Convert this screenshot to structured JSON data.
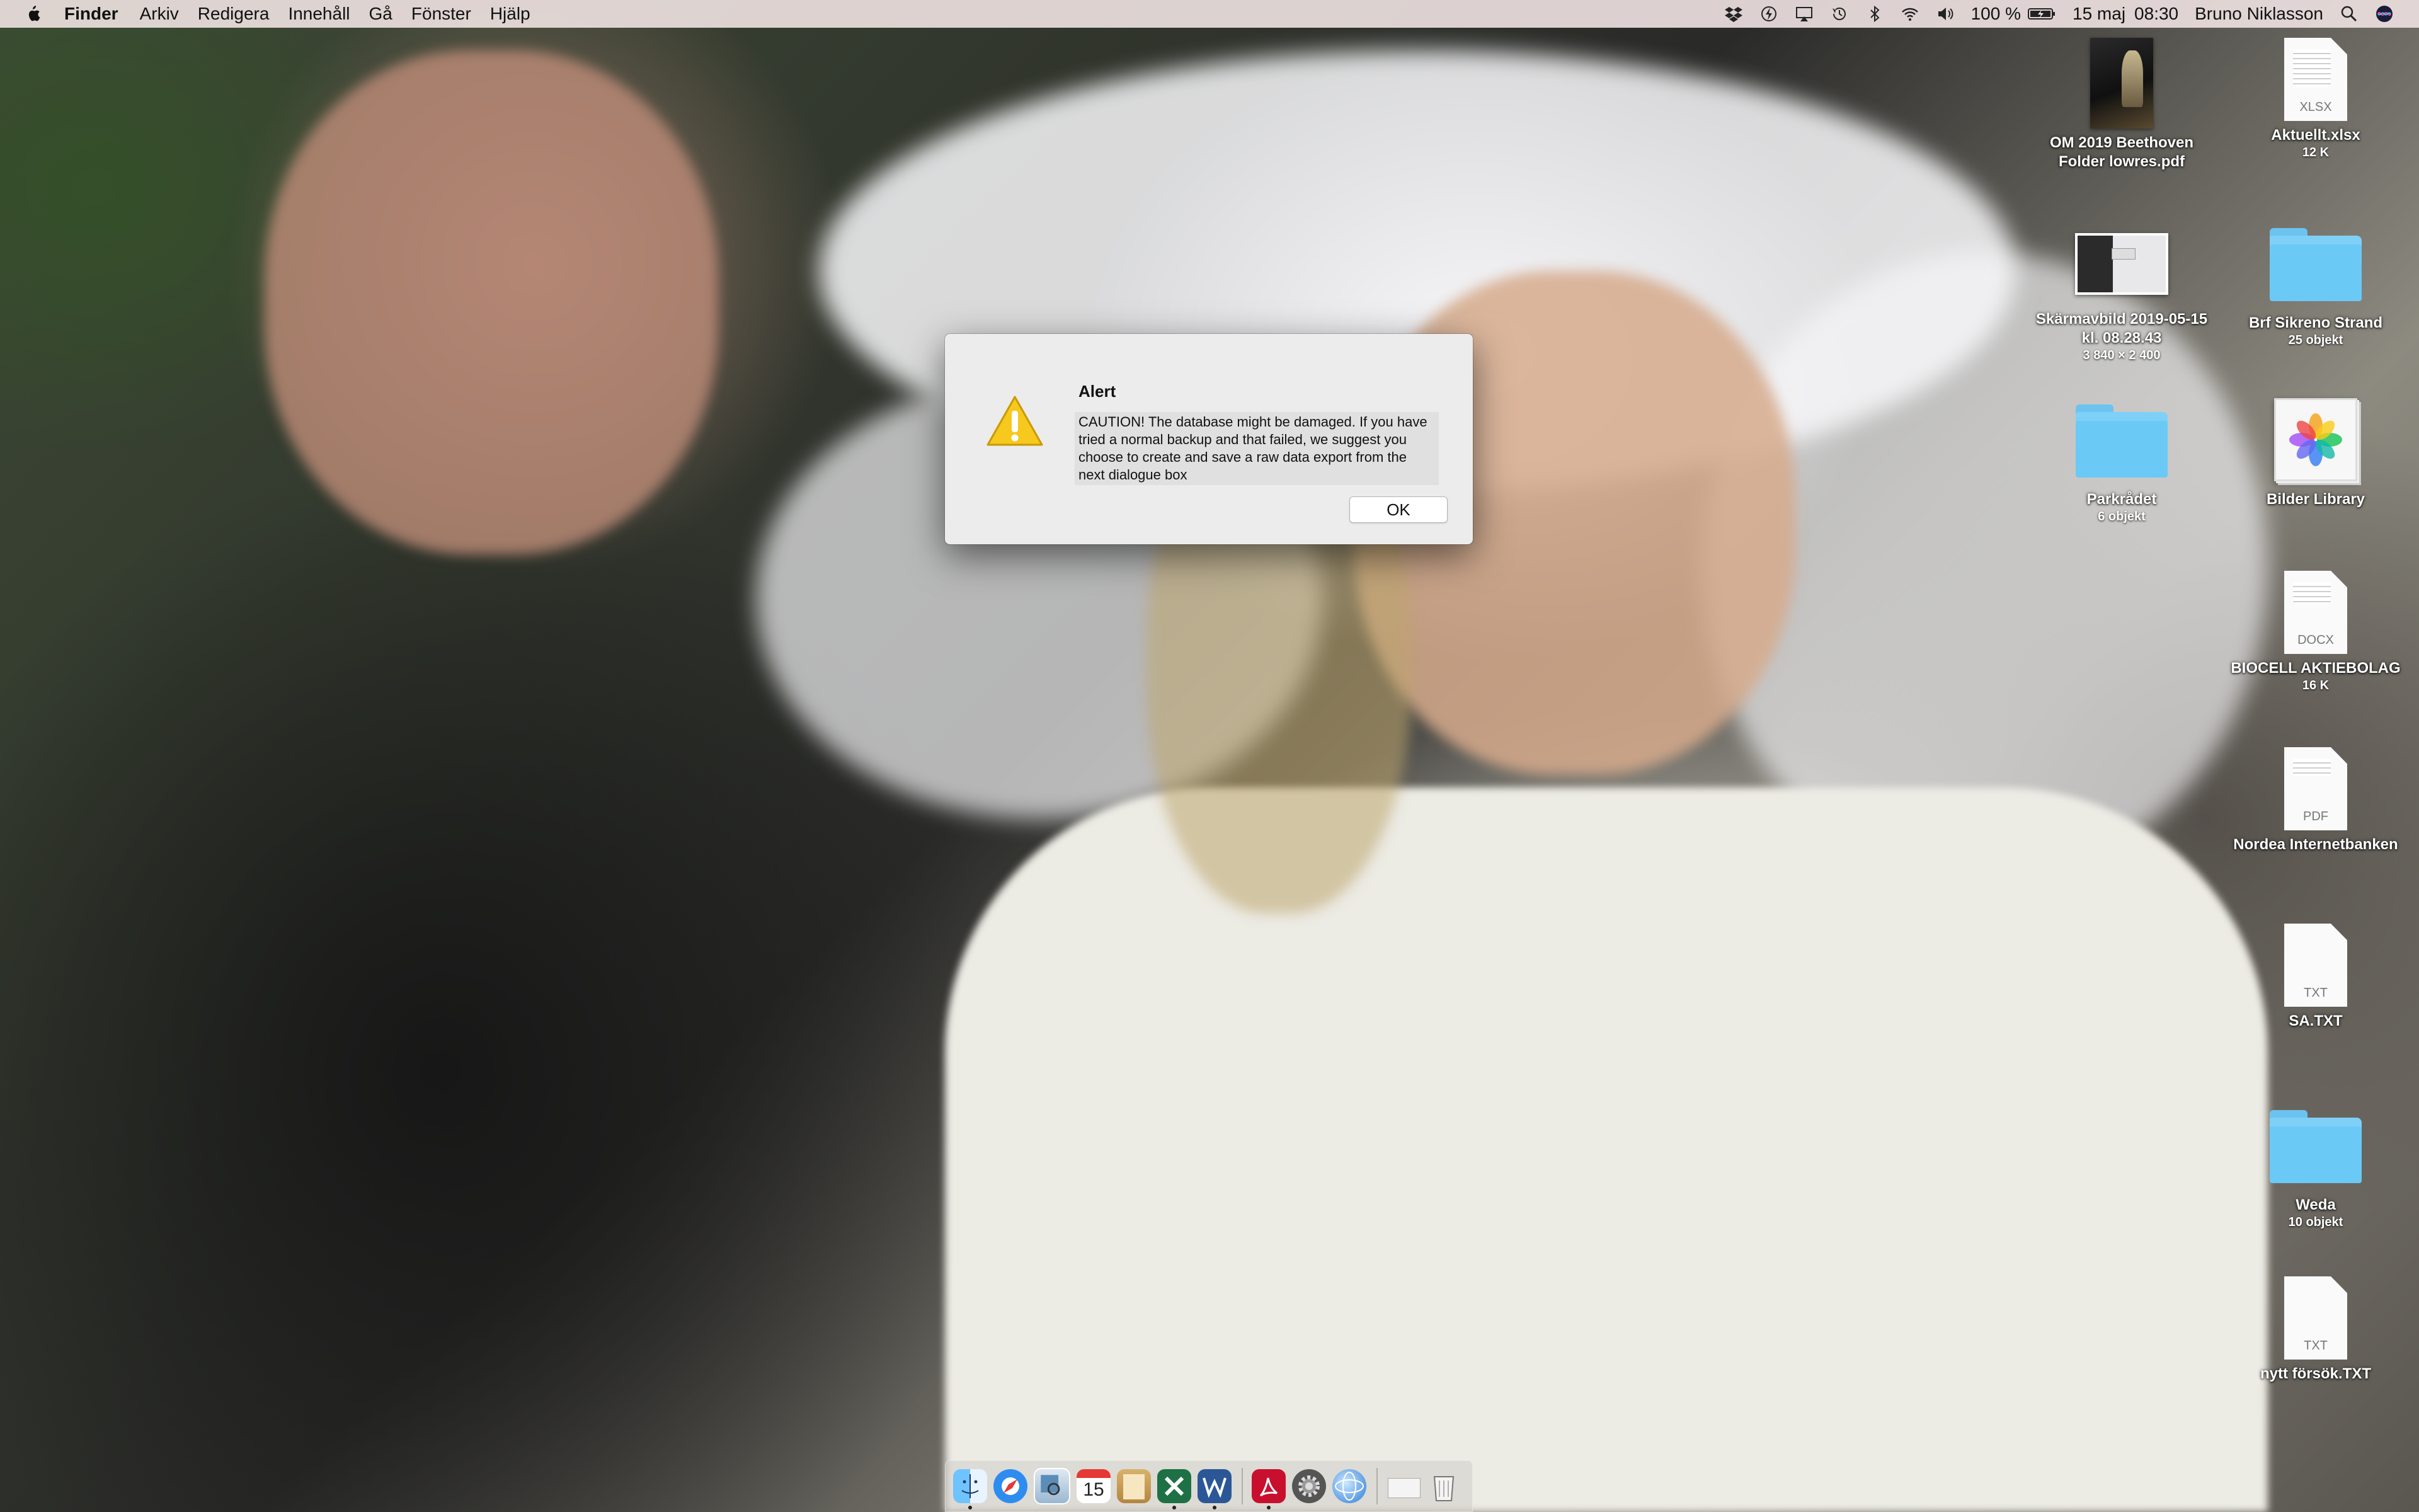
{
  "menubar": {
    "items": [
      "Finder",
      "Arkiv",
      "Redigera",
      "Innehåll",
      "Gå",
      "Fönster",
      "Hjälp"
    ],
    "status": {
      "battery": "100 %",
      "date": "15 maj",
      "time": "08:30",
      "user": "Bruno Niklasson"
    },
    "icons": [
      "dropbox-icon",
      "bolt-icon",
      "airplay-icon",
      "time-machine-icon",
      "bluetooth-icon",
      "wifi-icon",
      "volume-icon",
      "battery-icon",
      "spotlight-icon",
      "siri-icon"
    ]
  },
  "alert": {
    "title": "Alert",
    "message": "CAUTION! The database might be damaged. If you have tried a normal backup and that failed, we suggest you choose to create and save a raw data export from the next dialogue box",
    "ok_label": "OK"
  },
  "desktop_icons": [
    {
      "label": "OM 2019 Beethoven Folder lowres.pdf",
      "sub": "",
      "kind": "pdf-thumbnail"
    },
    {
      "label": "Aktuellt.xlsx",
      "sub": "12 K",
      "kind": "document",
      "ext": "XLSX"
    },
    {
      "label": "Skärmavbild 2019-05-15 kl. 08.28.43",
      "sub": "3 840 × 2 400",
      "kind": "image-thumbnail"
    },
    {
      "label": "Brf Sikreno Strand",
      "sub": "25 objekt",
      "kind": "folder"
    },
    {
      "label": "Parkrådet",
      "sub": "6 objekt",
      "kind": "folder"
    },
    {
      "label": "Bilder Library",
      "sub": "",
      "kind": "photos-library"
    },
    {
      "label": "BIOCELL AKTIEBOLAG",
      "sub": "16 K",
      "kind": "document",
      "ext": "DOCX"
    },
    {
      "label": "Nordea Internetbanken",
      "sub": "",
      "kind": "document",
      "ext": "PDF"
    },
    {
      "label": "SA.TXT",
      "sub": "",
      "kind": "document",
      "ext": "TXT"
    },
    {
      "label": "Weda",
      "sub": "10 objekt",
      "kind": "folder"
    },
    {
      "label": "nytt försök.TXT",
      "sub": "",
      "kind": "document",
      "ext": "TXT"
    }
  ],
  "calendar_day": "15",
  "colors": {
    "folder_blue": "#7fd0f7",
    "warning_yellow": "#f7c81e",
    "menubar_bg": "#ece0de"
  }
}
